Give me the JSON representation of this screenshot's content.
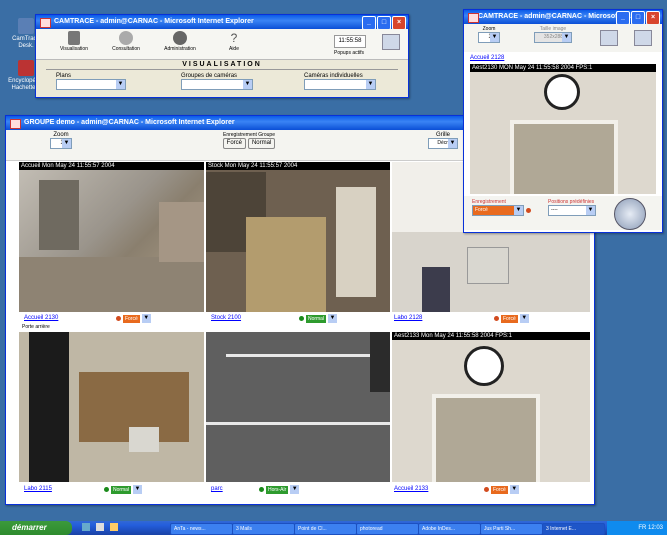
{
  "desktop": {
    "icons": [
      {
        "label": "CamTrace Desk."
      },
      {
        "label": "Encyclopédie Hachette..."
      }
    ]
  },
  "visu_window": {
    "title": "CAMTRACE - admin@CARNAC - Microsoft Internet Explorer",
    "toolbar": [
      {
        "label": "Visualisation"
      },
      {
        "label": "Consultation"
      },
      {
        "label": "Administration"
      },
      {
        "label": "Aide"
      }
    ],
    "clock": "11:55:58",
    "popups_label": "Popups actifs",
    "heading": "VISUALISATION",
    "fields": [
      {
        "label": "Plans"
      },
      {
        "label": "Groupes de caméras"
      },
      {
        "label": "Caméras individuelles"
      }
    ]
  },
  "group_window": {
    "title": "GROUPE demo - admin@CARNAC - Microsoft Internet Explorer",
    "zoom_label": "Zoom",
    "zoom_value": "1",
    "recording_label": "Enregistrement Groupe",
    "btn_force": "Forcé",
    "btn_normal": "Normal",
    "grid_label": "Grille",
    "grid_value": "Décré",
    "extra_label": "Porte arrière",
    "cameras": [
      {
        "osd": "Accueil  Mon May 24 11:55:57 2004",
        "name": "Accueil 2130",
        "mode": "Forcé",
        "status": "#d24b1e",
        "mode_color": "#e86a1e"
      },
      {
        "osd": "Stock  Mon May 24 11:55:57 2004",
        "name": "Stock 2100",
        "mode": "Normal",
        "status": "#1a8a1a",
        "mode_color": "#2e9b2e"
      },
      {
        "osd": "",
        "name": "Labo 2128",
        "mode": "Forcé",
        "status": "#d24b1e",
        "mode_color": "#e86a1e"
      },
      {
        "osd": "",
        "name": "Labo 2115",
        "mode": "Normal",
        "status": "#1a8a1a",
        "mode_color": "#2e9b2e"
      },
      {
        "osd": "",
        "name": "parc",
        "mode": "Hors-Alr",
        "status": "#1a8a1a",
        "mode_color": "#2e9b2e"
      },
      {
        "osd": "Aest2133  Mon May 24 11:55:58 2004  FPS:1",
        "name": "Accueil 2133",
        "mode": "Forcé",
        "status": "#d24b1e",
        "mode_color": "#e86a1e"
      }
    ]
  },
  "popup_window": {
    "title": "CAMTRACE - admin@CARNAC - Microsoft Int...",
    "zoom_label": "Zoom",
    "zoom_value": "1",
    "size_label": "Taille image",
    "size_value": "352x288",
    "cam_link": "Accueil 2128",
    "osd": "Aest2130  MON May 24 11:55:58 2004  FPS:1",
    "rec_label": "Enregistrement",
    "rec_value": "Forcé",
    "preset_label": "Positions prédéfinies",
    "preset_value": "----"
  },
  "taskbar": {
    "start_label": "démarrer",
    "tasks": [
      "AnTa - news...",
      "3 Mails",
      "Point de Cl...",
      "photoread",
      "Adobe InDes...",
      "Jus Parti Sh...",
      "3 Internet E..."
    ],
    "tray_text": "FR 12:03"
  }
}
